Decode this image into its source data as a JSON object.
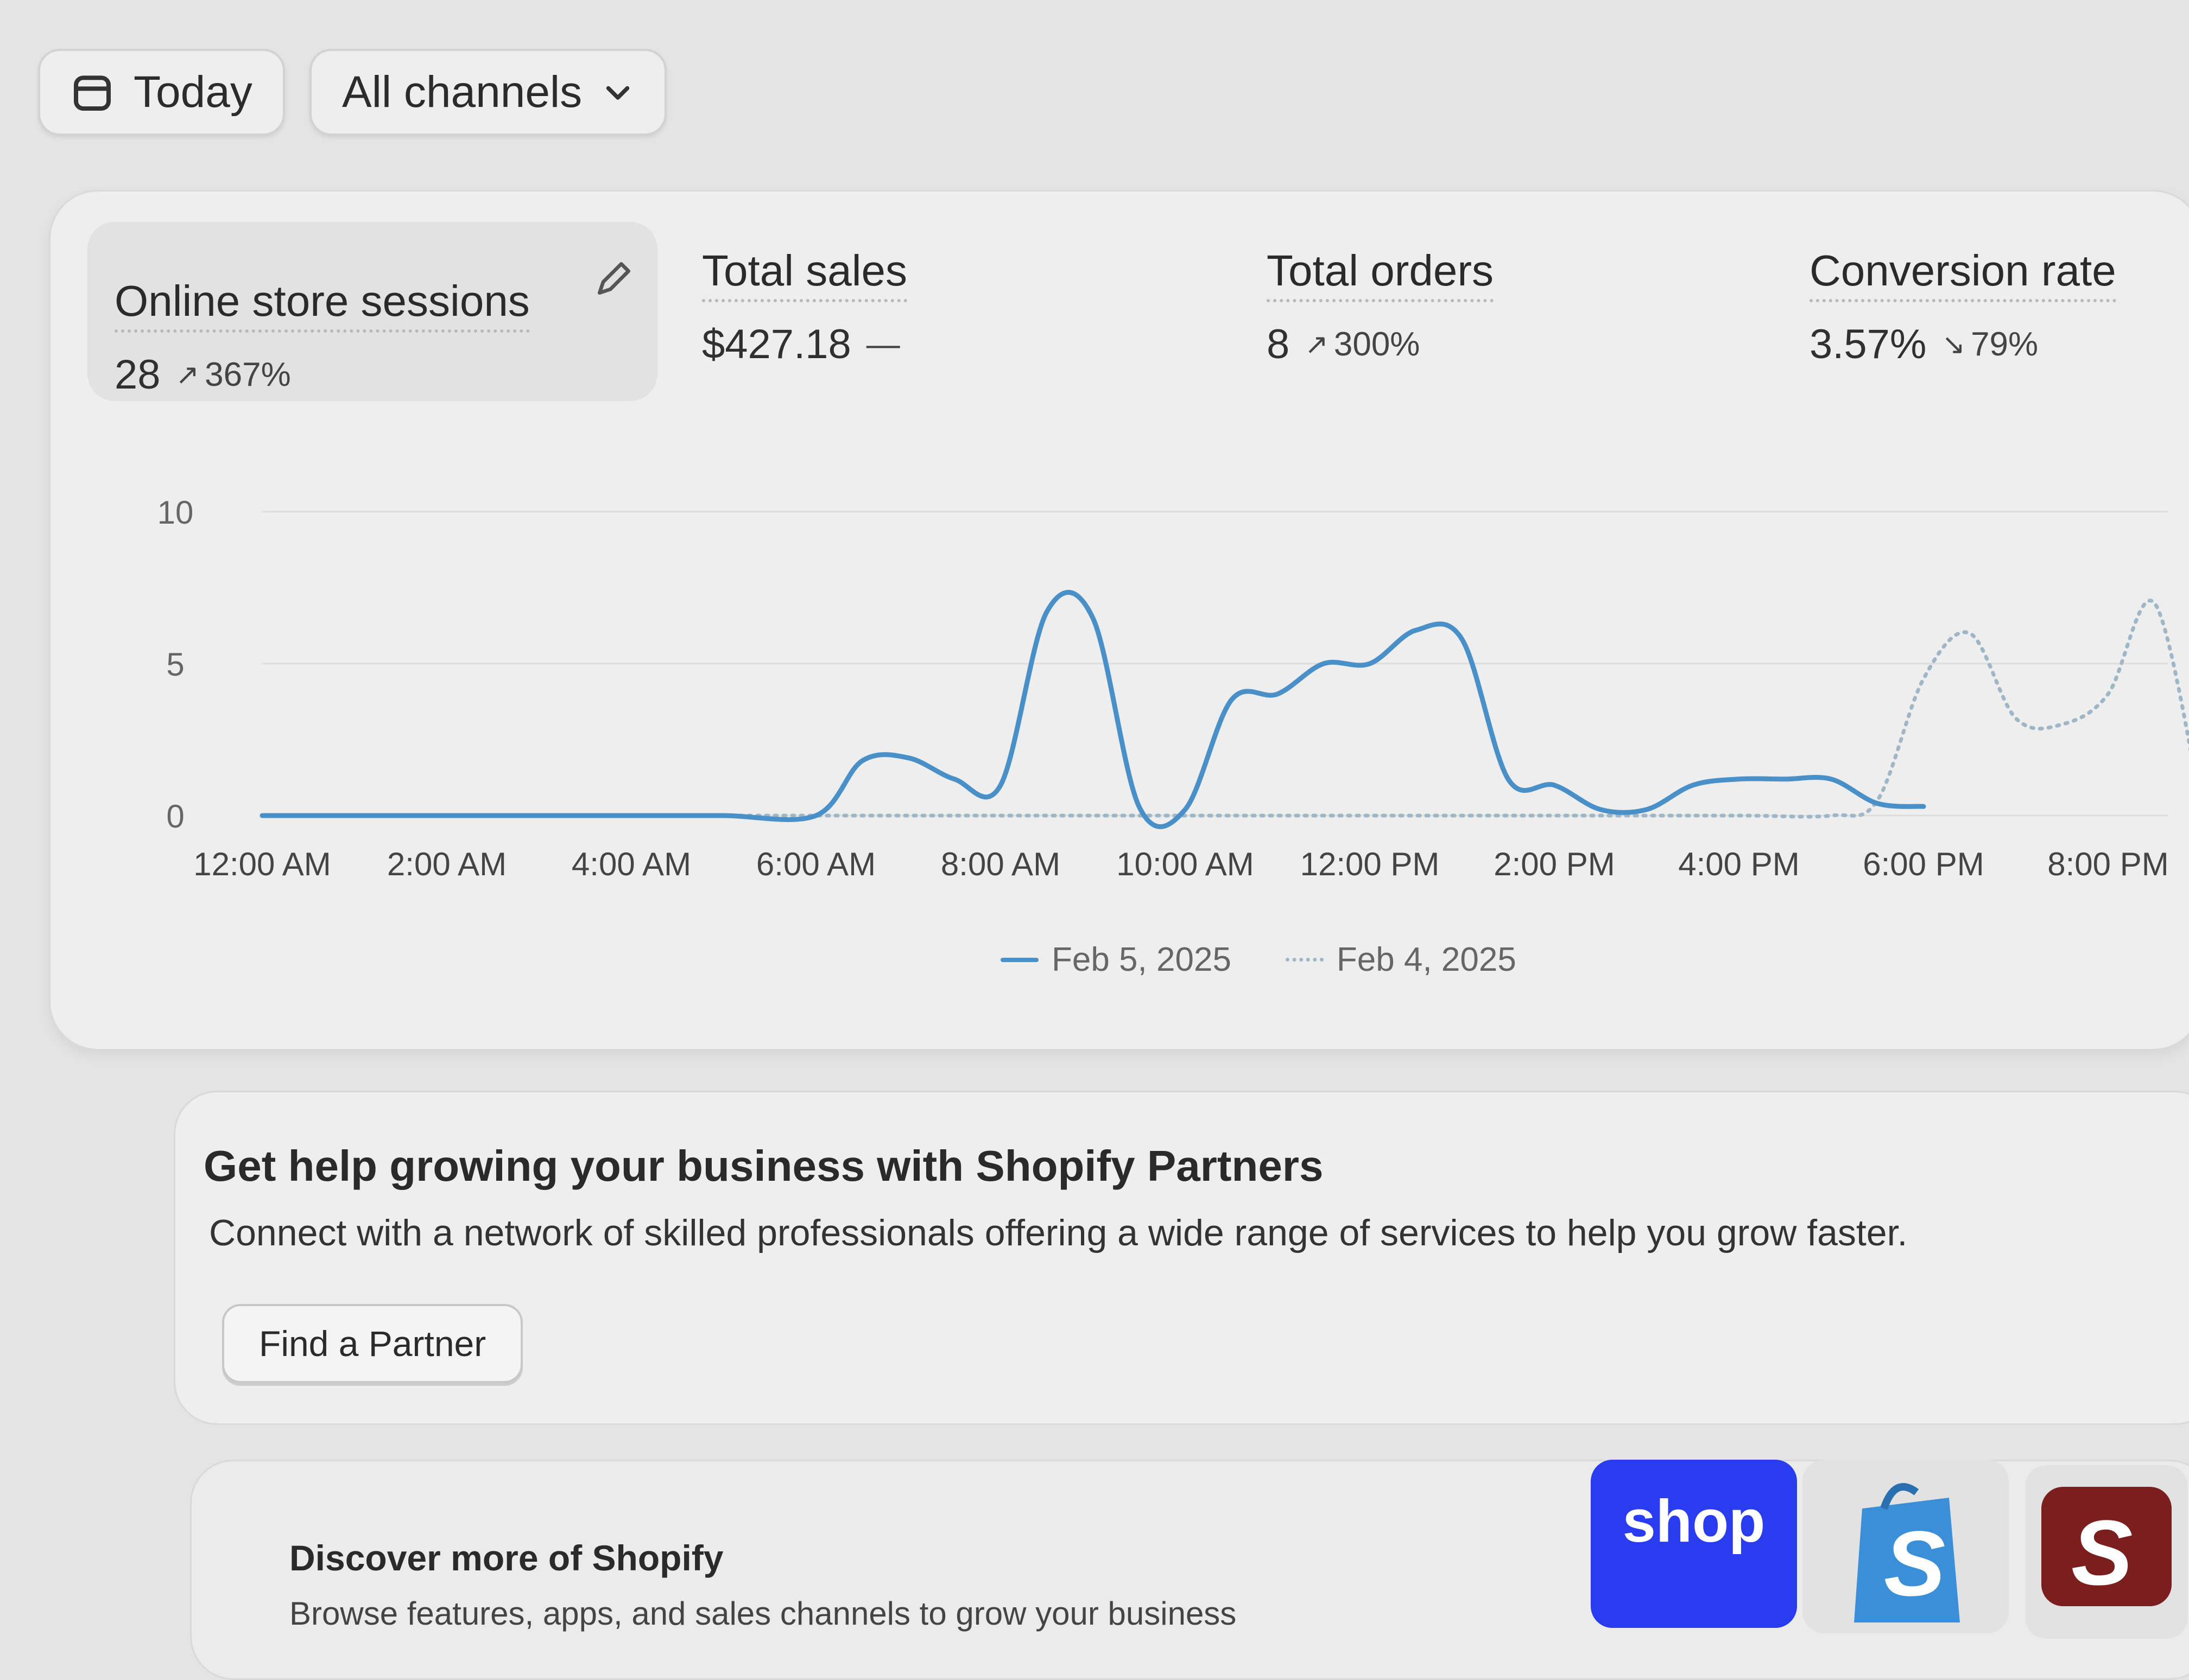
{
  "toolbar": {
    "date_label": "Today",
    "channel_label": "All channels"
  },
  "metrics": [
    {
      "label": "Online store sessions",
      "value": "28",
      "change": "367%",
      "direction": "up",
      "selected": true
    },
    {
      "label": "Total sales",
      "value": "$427.18",
      "change": "—",
      "direction": "none",
      "selected": false
    },
    {
      "label": "Total orders",
      "value": "8",
      "change": "300%",
      "direction": "up",
      "selected": false
    },
    {
      "label": "Conversion rate",
      "value": "3.57%",
      "change": "79%",
      "direction": "down",
      "selected": false
    }
  ],
  "chart_data": {
    "type": "line",
    "y_ticks": [
      "10",
      "5",
      "0"
    ],
    "ylim": [
      0,
      10
    ],
    "x_tick_labels": [
      "12:00 AM",
      "2:00 AM",
      "4:00 AM",
      "6:00 AM",
      "8:00 AM",
      "10:00 AM",
      "12:00 PM",
      "2:00 PM",
      "4:00 PM",
      "6:00 PM",
      "8:00 PM"
    ],
    "x_hours": [
      0,
      1,
      2,
      3,
      4,
      5,
      6,
      6.5,
      7,
      7.5,
      8,
      8.5,
      9,
      9.5,
      10,
      10.5,
      11,
      11.5,
      12,
      12.5,
      13,
      13.5,
      14,
      14.5,
      15,
      15.5,
      16,
      16.5,
      17,
      17.5,
      18
    ],
    "series": [
      {
        "name": "Feb 5, 2025",
        "style": "solid",
        "color": "#4a90c8",
        "values": [
          0,
          0,
          0,
          0,
          0,
          0,
          0,
          1.8,
          1.9,
          1.2,
          1,
          6.7,
          6.5,
          0.3,
          0.2,
          3.8,
          4,
          5,
          5,
          6.1,
          5.8,
          1.2,
          1,
          0.2,
          0.2,
          1,
          1.2,
          1.2,
          1.2,
          0.4,
          0.3
        ]
      },
      {
        "name": "Feb 4, 2025",
        "style": "dotted",
        "color": "#9fb6c6",
        "hours": [
          0,
          3,
          6,
          9,
          12,
          14,
          16,
          17,
          17.5,
          18,
          18.5,
          19,
          19.5,
          20,
          20.5,
          21
        ],
        "values": [
          0,
          0,
          0,
          0,
          0,
          0,
          0,
          0,
          0.5,
          4.5,
          6,
          3.2,
          3,
          4,
          7,
          0.5
        ]
      }
    ],
    "legend_position": "bottom-center",
    "grid": true
  },
  "partners_card": {
    "title": "Get help growing your business with Shopify Partners",
    "description": "Connect with a network of skilled professionals offering a wide range of services to help you grow faster.",
    "button_label": "Find a Partner"
  },
  "discover_card": {
    "title": "Discover more of Shopify",
    "description": "Browse features, apps, and sales channels to grow your business",
    "shop_logo_text": "shop"
  }
}
